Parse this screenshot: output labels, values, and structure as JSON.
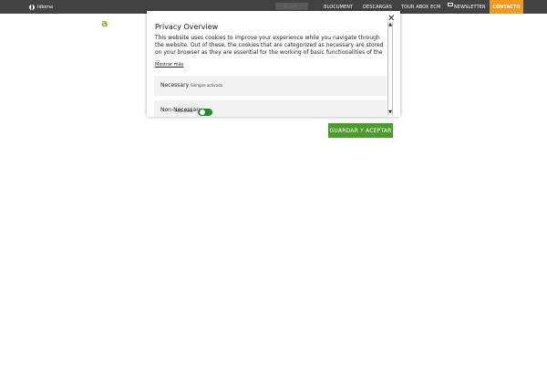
{
  "topbar": {
    "language_label": "Idioma",
    "search_placeholder": "Buscar...",
    "nav": [
      "BLOCUMENT",
      "DESCARGAS",
      "TOUR ABOX ECM",
      "NEWSLETTER"
    ],
    "contact_label": "CONTACTO"
  },
  "logo": {
    "text": "a"
  },
  "modal": {
    "title": "Privacy Overview",
    "description": "This website uses cookies to improve your experience while you navigate through the website. Out of these, the cookies that are categorized as necessary are stored on your browser as they are essential for the working of basic functionalities of the ...",
    "show_more": "Mostrar más",
    "close_symbol": "✕",
    "sections": [
      {
        "title": "Necessary",
        "status": "Siempre activado"
      },
      {
        "title": "Non-Necessary",
        "toggle_label": "Activado",
        "toggle_state": true
      }
    ]
  },
  "save_button": "GUARDAR Y ACEPTAR",
  "colors": {
    "topbar": "#434343",
    "contact": "#f39a1e",
    "accent_green": "#4c9b2f",
    "logo_green": "#8cb536"
  }
}
